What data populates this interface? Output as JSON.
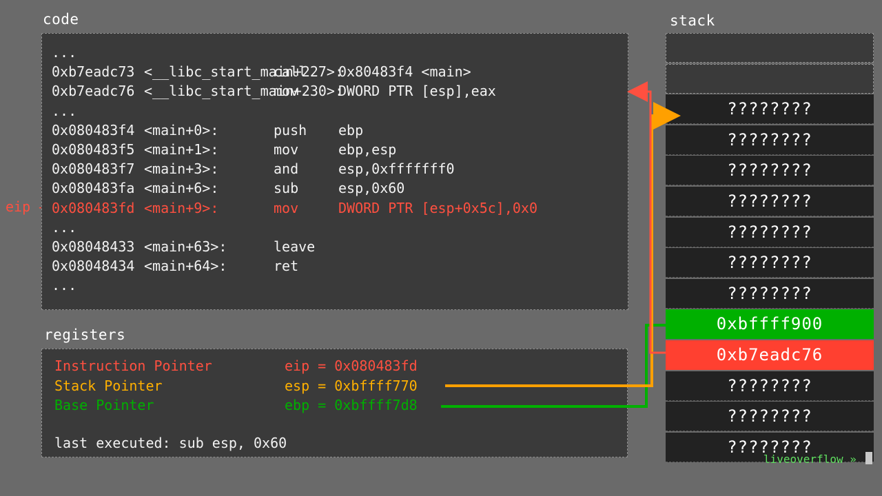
{
  "titles": {
    "code": "code",
    "registers": "registers",
    "stack": "stack"
  },
  "code": {
    "lines": [
      {
        "addr": "...",
        "sym": "",
        "op": "",
        "args": ""
      },
      {
        "addr": "0xb7eadc73",
        "sym": "<__libc_start_main+227>:",
        "op": "call",
        "args": "0x80483f4 <main>"
      },
      {
        "addr": "0xb7eadc76",
        "sym": "<__libc_start_main+230>:",
        "op": "mov",
        "args": "DWORD PTR [esp],eax"
      },
      {
        "addr": "...",
        "sym": "",
        "op": "",
        "args": ""
      },
      {
        "addr": "0x080483f4",
        "sym": "<main+0>:",
        "op": "push",
        "args": "ebp"
      },
      {
        "addr": "0x080483f5",
        "sym": "<main+1>:",
        "op": "mov",
        "args": "ebp,esp"
      },
      {
        "addr": "0x080483f7",
        "sym": "<main+3>:",
        "op": "and",
        "args": "esp,0xfffffff0"
      },
      {
        "addr": "0x080483fa",
        "sym": "<main+6>:",
        "op": "sub",
        "args": "esp,0x60"
      },
      {
        "addr": "0x080483fd",
        "sym": "<main+9>:",
        "op": "mov",
        "args": "DWORD PTR [esp+0x5c],0x0"
      },
      {
        "addr": "...",
        "sym": "",
        "op": "",
        "args": ""
      },
      {
        "addr": "0x08048433",
        "sym": "<main+63>:",
        "op": "leave",
        "args": ""
      },
      {
        "addr": "0x08048434",
        "sym": "<main+64>:",
        "op": "ret",
        "args": ""
      },
      {
        "addr": "...",
        "sym": "",
        "op": "",
        "args": ""
      }
    ],
    "eip_label": "eip"
  },
  "registers": {
    "rows": [
      {
        "name": "Instruction Pointer",
        "value": "eip = 0x080483fd",
        "color": "#ff5040"
      },
      {
        "name": "Stack Pointer",
        "value": "esp = 0xbffff770",
        "color": "#ffb000"
      },
      {
        "name": "Base Pointer",
        "value": "ebp = 0xbffff7d8",
        "color": "#00b000"
      }
    ],
    "last_executed": "last executed: sub esp, 0x60"
  },
  "stack": {
    "slots": [
      {
        "value": "",
        "kind": "empty"
      },
      {
        "value": "",
        "kind": "empty"
      },
      {
        "value": "????????",
        "kind": "unk"
      },
      {
        "value": "????????",
        "kind": "unk"
      },
      {
        "value": "????????",
        "kind": "unk"
      },
      {
        "value": "????????",
        "kind": "unk"
      },
      {
        "value": "????????",
        "kind": "unk"
      },
      {
        "value": "????????",
        "kind": "unk"
      },
      {
        "value": "????????",
        "kind": "unk"
      },
      {
        "value": "0xbffff900",
        "kind": "green"
      },
      {
        "value": "0xb7eadc76",
        "kind": "red"
      },
      {
        "value": "????????",
        "kind": "unk"
      },
      {
        "value": "????????",
        "kind": "unk"
      },
      {
        "value": "????????",
        "kind": "unk"
      }
    ]
  },
  "colors": {
    "esp_arrow": "#ffa000",
    "ebp_arrow": "#00b000",
    "ret_arrow": "#ff5040"
  },
  "watermark": "liveoverflow »"
}
